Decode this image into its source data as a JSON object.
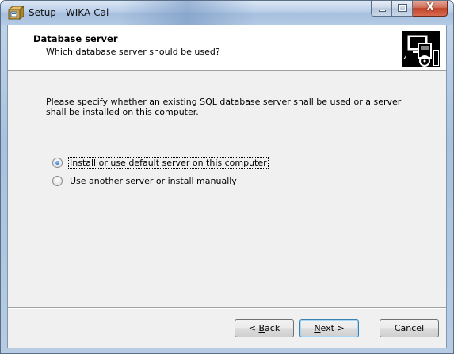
{
  "window": {
    "title": "Setup - WIKA-Cal",
    "app_icon": "setup-box-icon",
    "controls": {
      "minimize": "minimize-icon",
      "maximize": "maximize-icon",
      "close_glyph": "X"
    }
  },
  "header": {
    "title": "Database server",
    "subtitle": "Which database server should be used?",
    "icon": "computer-setup-icon"
  },
  "body": {
    "description": "Please specify whether an existing SQL database server shall be used or a server shall be installed on this computer.",
    "options": [
      {
        "label": "Install or use default server on this computer",
        "selected": true
      },
      {
        "label": "Use another server or install manually",
        "selected": false
      }
    ]
  },
  "buttons": {
    "back": {
      "prefix": "< ",
      "mnemonic": "B",
      "rest": "ack"
    },
    "next": {
      "mnemonic": "N",
      "rest": "ext >"
    },
    "cancel": "Cancel"
  },
  "colors": {
    "titlebar": "#b9cee8",
    "client_bg": "#f0f0f0",
    "header_bg": "#ffffff",
    "close_button": "#c2452b",
    "default_button_border": "#3c7fb1"
  }
}
